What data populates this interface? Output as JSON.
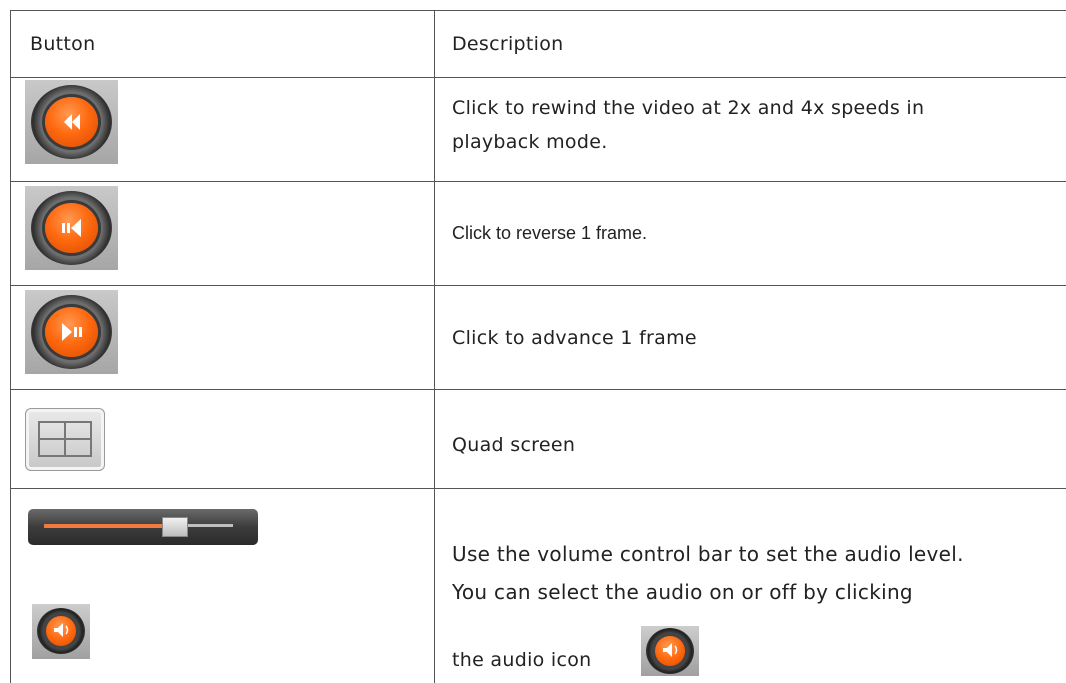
{
  "table": {
    "headers": {
      "button": "Button",
      "description": "Description"
    },
    "rows": [
      {
        "icon": "rewind-icon",
        "description_line1": "Click to rewind the video at 2x and 4x speeds in",
        "description_line2": "playback mode."
      },
      {
        "icon": "frame-reverse-icon",
        "description": "Click to reverse 1 frame."
      },
      {
        "icon": "frame-advance-icon",
        "description": "Click to advance 1 frame"
      },
      {
        "icon": "quad-screen-icon",
        "description": "Quad screen"
      },
      {
        "icons": [
          "volume-slider",
          "audio-icon"
        ],
        "description_line1": "Use the volume control bar to set the audio level.",
        "description_line2": "You can select the audio on or off by clicking",
        "description_line3": "the audio icon"
      }
    ]
  },
  "volume": {
    "level": 0.78
  },
  "colors": {
    "accent_orange": "#ff6a10",
    "border": "#555555"
  }
}
